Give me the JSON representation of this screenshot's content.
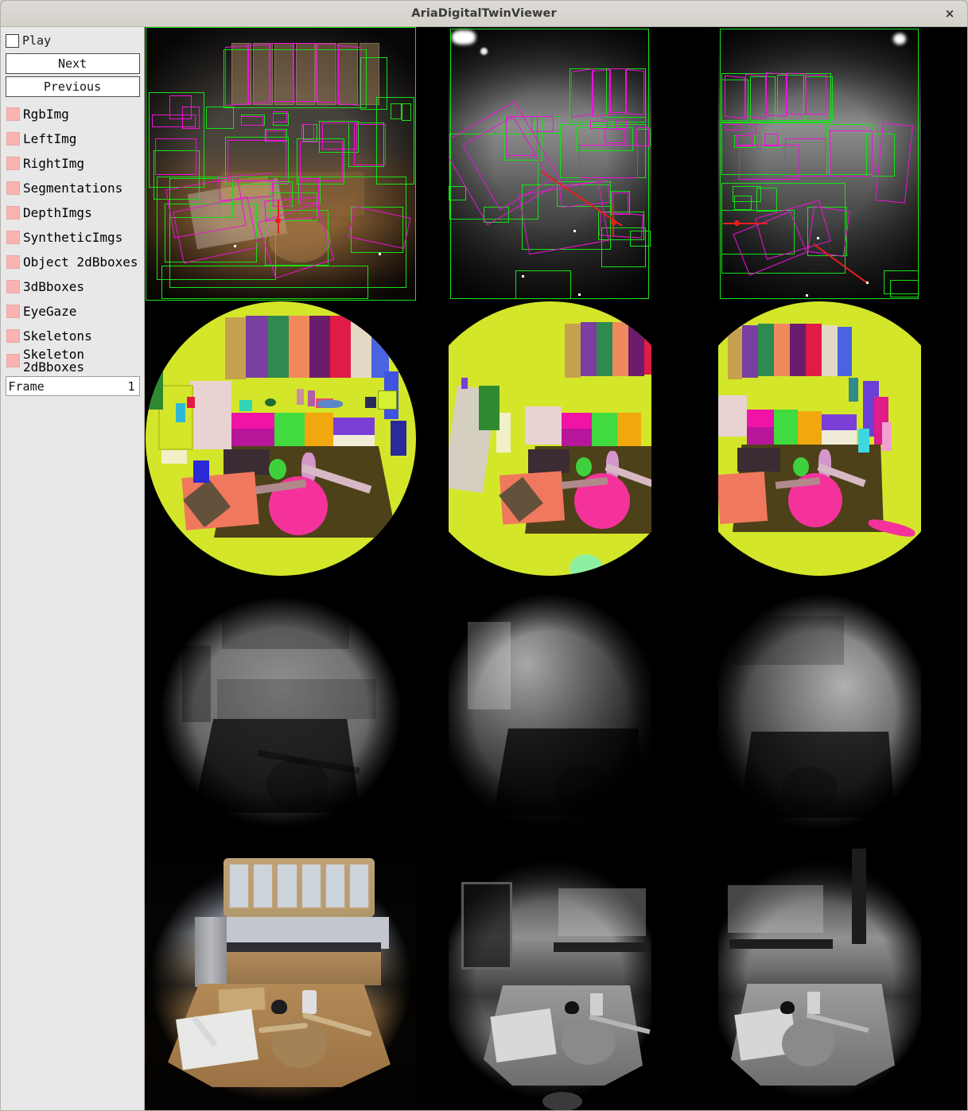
{
  "window": {
    "title": "AriaDigitalTwinViewer",
    "close_label": "×",
    "close_icon": "close-icon"
  },
  "sidebar": {
    "play": {
      "label": "Play",
      "checked": false
    },
    "buttons": [
      {
        "name": "next-button",
        "label": "Next"
      },
      {
        "name": "previous-button",
        "label": "Previous"
      }
    ],
    "toggles": [
      {
        "name": "rgb-img",
        "label": "RgbImg",
        "color": "#f9b3b1"
      },
      {
        "name": "left-img",
        "label": "LeftImg",
        "color": "#f9b3b1"
      },
      {
        "name": "right-img",
        "label": "RightImg",
        "color": "#f9b3b1"
      },
      {
        "name": "segmentations",
        "label": "Segmentations",
        "color": "#f9b3b1"
      },
      {
        "name": "depth-imgs",
        "label": "DepthImgs",
        "color": "#f9b3b1"
      },
      {
        "name": "synthetic-imgs",
        "label": "SyntheticImgs",
        "color": "#f9b3b1"
      },
      {
        "name": "object-2dbboxes",
        "label": "Object 2dBboxes",
        "color": "#f9b3b1"
      },
      {
        "name": "3dbboxes",
        "label": "3dBboxes",
        "color": "#f9b3b1"
      },
      {
        "name": "eyegaze",
        "label": "EyeGaze",
        "color": "#f9b3b1"
      },
      {
        "name": "skeletons",
        "label": "Skeletons",
        "color": "#f9b3b1"
      },
      {
        "name": "skeleton-2dbboxes",
        "label": "Skeleton 2dBboxes",
        "color": "#f9b3b1"
      }
    ],
    "frame": {
      "label": "Frame",
      "value": "1"
    }
  },
  "viewport": {
    "columns": [
      {
        "name": "rgb-camera",
        "aspect": "square"
      },
      {
        "name": "left-slam-camera",
        "aspect": "portrait"
      },
      {
        "name": "right-slam-camera",
        "aspect": "portrait"
      }
    ],
    "rows": [
      {
        "name": "camera-images-row",
        "content": "camera-with-bbox-overlays"
      },
      {
        "name": "segmentation-row",
        "content": "instance-segmentation"
      },
      {
        "name": "depth-row",
        "content": "depth-map"
      },
      {
        "name": "synthetic-row",
        "content": "synthetic-render"
      }
    ],
    "overlay_colors": {
      "object_2dbbox": "#18e018",
      "object_3dbbox": "#f012d8",
      "eyegaze_ray": "#ec1d1d",
      "segmentation_background": "#d4e629"
    }
  }
}
